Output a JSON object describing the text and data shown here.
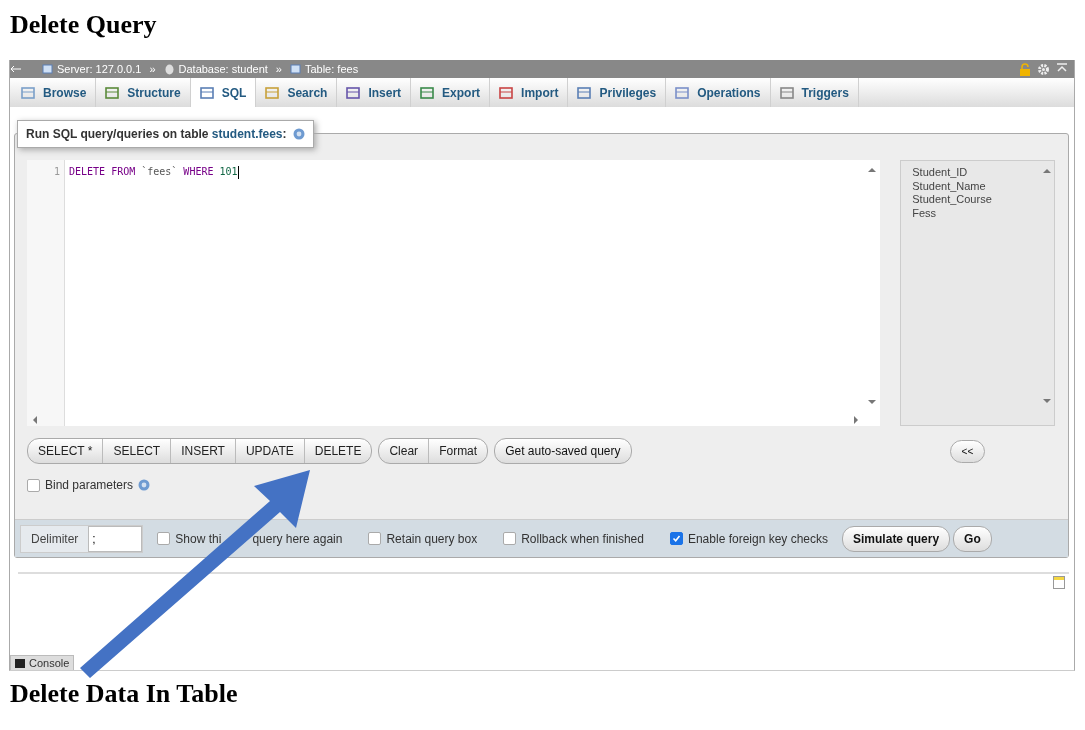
{
  "title": "Delete Query",
  "breadcrumb": {
    "separator": "»",
    "items": [
      {
        "label": "Server: 127.0.0.1",
        "kind": "server"
      },
      {
        "label": "Database: student",
        "kind": "database"
      },
      {
        "label": "Table: fees",
        "kind": "table"
      }
    ]
  },
  "tabs": [
    {
      "label": "Browse",
      "selected": false
    },
    {
      "label": "Structure",
      "selected": false
    },
    {
      "label": "SQL",
      "selected": true
    },
    {
      "label": "Search",
      "selected": false
    },
    {
      "label": "Insert",
      "selected": false
    },
    {
      "label": "Export",
      "selected": false
    },
    {
      "label": "Import",
      "selected": false
    },
    {
      "label": "Privileges",
      "selected": false
    },
    {
      "label": "Operations",
      "selected": false
    },
    {
      "label": "Triggers",
      "selected": false
    }
  ],
  "legend": {
    "prefix": "Run SQL query/queries on table ",
    "link": "student.fees",
    "suffix": ":"
  },
  "editor": {
    "line_number": "1",
    "tokens": [
      {
        "text": "DELETE FROM",
        "kind": "keyword"
      },
      {
        "text": "`fees`",
        "kind": "string"
      },
      {
        "text": "WHERE",
        "kind": "keyword"
      },
      {
        "text": "101",
        "kind": "number"
      }
    ]
  },
  "columns": [
    "Student_ID",
    "Student_Name",
    "Student_Course",
    "Fess"
  ],
  "query_buttons": [
    [
      "SELECT *",
      "SELECT",
      "INSERT",
      "UPDATE",
      "DELETE"
    ],
    [
      "Clear",
      "Format"
    ],
    [
      "Get auto-saved query"
    ]
  ],
  "insert_button": "<<",
  "bind_parameters": {
    "label": "Bind parameters",
    "checked": false
  },
  "delimiter": {
    "label": "Delimiter",
    "value": ";"
  },
  "options": [
    {
      "label": "Show thi",
      "label_continued": "query here again",
      "checked": false
    },
    {
      "label": "Retain query box",
      "checked": false
    },
    {
      "label": "Rollback when finished",
      "checked": false
    },
    {
      "label": "Enable foreign key checks",
      "checked": true
    }
  ],
  "actions": [
    "Simulate query",
    "Go"
  ],
  "console": "Console",
  "caption": "Delete Data In Table"
}
